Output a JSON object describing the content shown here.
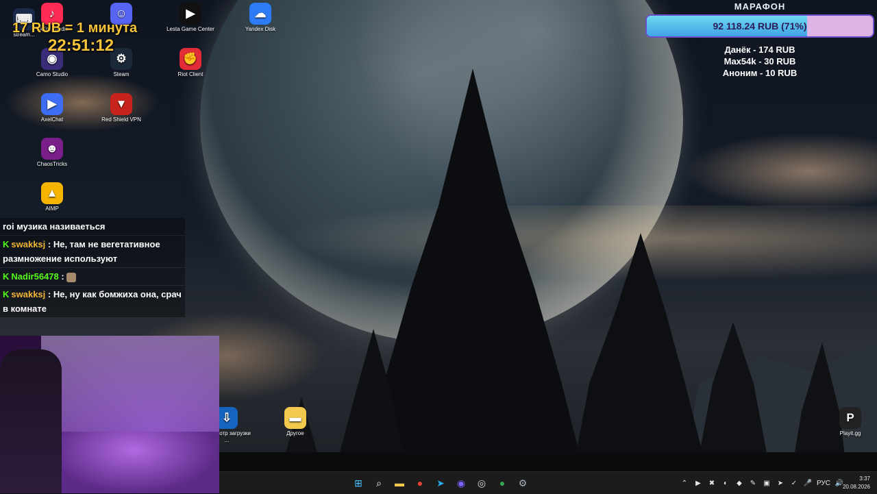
{
  "desktop_icons": [
    {
      "label": "stream...",
      "glyph": "⌨",
      "color": "#1b2a4a",
      "name": "streamer-icon"
    },
    {
      "label": "TikTok Studio",
      "glyph": "♪",
      "color": "#fe2c55",
      "name": "tiktok-studio-icon"
    },
    {
      "label": "",
      "glyph": "☺",
      "color": "#5865f2",
      "name": "discord-icon"
    },
    {
      "label": "Lesta Game Center",
      "glyph": "▶",
      "color": "#111111",
      "name": "lesta-game-center-icon"
    },
    {
      "label": "Yandex Disk",
      "glyph": "☁",
      "color": "#2d7cf6",
      "name": "yandex-disk-icon"
    },
    {
      "label": "Camo Studio",
      "glyph": "◉",
      "color": "#3b2c78",
      "name": "camo-studio-icon"
    },
    {
      "label": "Steam",
      "glyph": "⚙",
      "color": "#1b2838",
      "name": "steam-icon"
    },
    {
      "label": "Riot Client",
      "glyph": "✊",
      "color": "#e22d38",
      "name": "riot-client-icon"
    },
    {
      "label": "AxelChat",
      "glyph": "▶",
      "color": "#3d6df2",
      "name": "axelchat-icon"
    },
    {
      "label": "Red Shield VPN",
      "glyph": "▼",
      "color": "#c8241e",
      "name": "red-shield-vpn-icon"
    },
    {
      "label": "ChaosTricks",
      "glyph": "☻",
      "color": "#7a1f8a",
      "name": "chaostricks-icon"
    },
    {
      "label": "AIMP",
      "glyph": "▲",
      "color": "#f4b400",
      "name": "aimp-icon"
    },
    {
      "label": "Просмотр загрузки ...",
      "glyph": "⇩",
      "color": "#1565c0",
      "name": "downloads-icon"
    },
    {
      "label": "Другое",
      "glyph": "▬",
      "color": "#f2c94c",
      "name": "folder-other-icon"
    },
    {
      "label": "Playit.gg",
      "glyph": "P",
      "color": "#222222",
      "name": "playit-icon"
    }
  ],
  "overlay": {
    "rate": "17 RUB = 1 минута",
    "timer": "22:51:12"
  },
  "marathon": {
    "title": "МАРАФОН",
    "progress_text": "92 118.24 RUB (71%)",
    "progress_percent": 71,
    "donors": [
      "Данёк - 174 RUB",
      "Max54k - 30 RUB",
      "Аноним - 10 RUB"
    ]
  },
  "chat": [
    {
      "user": "",
      "message": "roi музика називаеться",
      "badge": false
    },
    {
      "user": "swakksj",
      "message": "Не, там не вегетативное размножение используют",
      "badge": true,
      "color": "a"
    },
    {
      "user": "Nadir56478",
      "message": "",
      "badge": true,
      "color": "b",
      "emote": true
    },
    {
      "user": "swakksj",
      "message": "Не, ну как бомжиха она, срач в комнате",
      "badge": true,
      "color": "a"
    }
  ],
  "taskbar": {
    "apps": [
      {
        "name": "windows-start-icon",
        "glyph": "⊞",
        "color": "#4cc2ff"
      },
      {
        "name": "search-icon",
        "glyph": "⌕",
        "color": "#ffffff"
      },
      {
        "name": "file-explorer-icon",
        "glyph": "▬",
        "color": "#f2c94c"
      },
      {
        "name": "chrome-icon",
        "glyph": "●",
        "color": "#ea4335"
      },
      {
        "name": "telegram-icon",
        "glyph": "➤",
        "color": "#2aabee"
      },
      {
        "name": "camo-icon",
        "glyph": "◉",
        "color": "#7b61ff"
      },
      {
        "name": "obs-icon",
        "glyph": "◎",
        "color": "#dddddd"
      },
      {
        "name": "chrome-2-icon",
        "glyph": "●",
        "color": "#34a853"
      },
      {
        "name": "settings-icon",
        "glyph": "⚙",
        "color": "#aab4c0"
      }
    ],
    "tray": [
      "⌃",
      "▶",
      "✖",
      "◐",
      "◆",
      "✎",
      "▣",
      "➤",
      "✓",
      "🎤"
    ],
    "lang": "РУС",
    "time": "3:37",
    "date": "20.08.2026"
  }
}
